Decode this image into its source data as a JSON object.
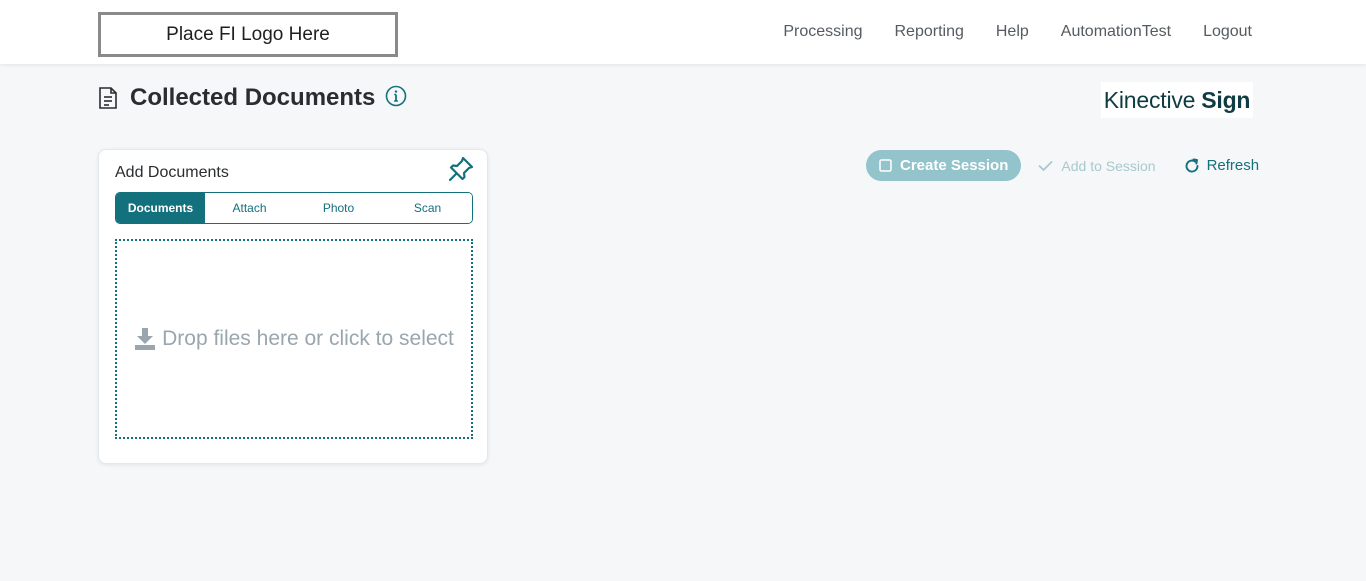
{
  "header": {
    "logo_placeholder": "Place FI Logo Here",
    "nav": [
      "Processing",
      "Reporting",
      "Help",
      "AutomationTest",
      "Logout"
    ]
  },
  "page": {
    "title": "Collected Documents",
    "brand_part1": "Kinective",
    "brand_part2": "Sign"
  },
  "add_documents": {
    "title": "Add Documents",
    "tabs": [
      "Documents",
      "Attach",
      "Photo",
      "Scan"
    ],
    "active_tab": "Documents",
    "dropzone_text": "Drop files here or click to select"
  },
  "actions": {
    "create_session": "Create Session",
    "add_to_session": "Add to Session",
    "refresh": "Refresh"
  },
  "colors": {
    "primary": "#13707d",
    "disabled_button": "#93c3cb",
    "background": "#f5f7f9"
  },
  "icons": [
    "document-icon",
    "info-icon",
    "pin-icon",
    "download-icon",
    "checkbox-icon",
    "check-icon",
    "refresh-icon"
  ]
}
